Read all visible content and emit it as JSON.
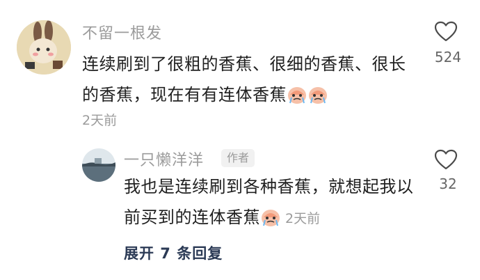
{
  "comment": {
    "username": "不留一根发",
    "text": "连续刷到了很粗的香蕉、很细的香蕉、很长的香蕉，现在有有连体香蕉",
    "time": "2天前",
    "like_count": "524"
  },
  "reply": {
    "username": "一只懒洋洋",
    "badge": "作者",
    "text": "我也是连续刷到各种香蕉，就想起我以前买到的连体香蕉",
    "time": "2天前",
    "like_count": "32"
  },
  "expand_label": "展开 7 条回复"
}
